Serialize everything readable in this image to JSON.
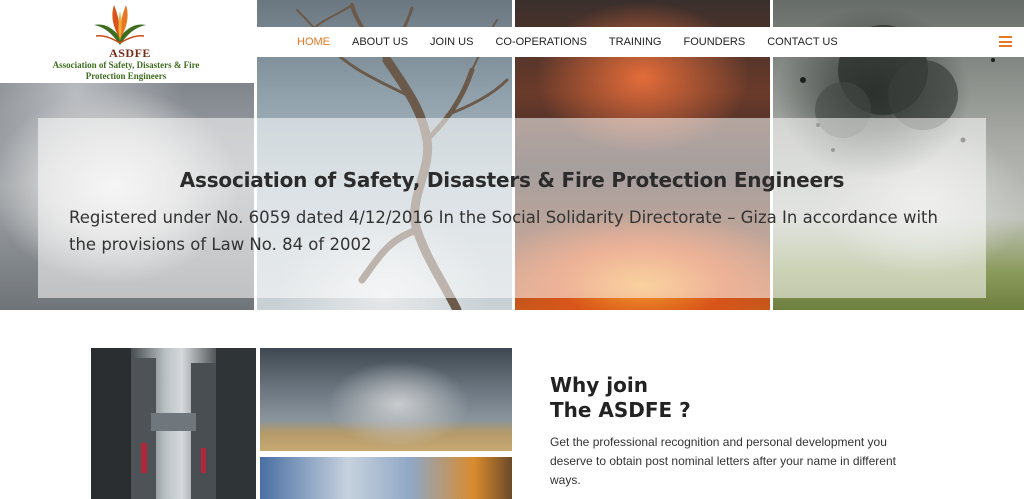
{
  "logo": {
    "title": "ASDFE",
    "subtitle": "Association of Safety, Disasters & Fire Protection Engineers",
    "icon": "flame-leaf-logo"
  },
  "nav": {
    "items": [
      {
        "label": "HOME",
        "active": true
      },
      {
        "label": "ABOUT US",
        "active": false
      },
      {
        "label": "JOIN US",
        "active": false
      },
      {
        "label": "CO-OPERATIONS",
        "active": false
      },
      {
        "label": "TRAINING",
        "active": false
      },
      {
        "label": "FOUNDERS",
        "active": false
      },
      {
        "label": "CONTACT US",
        "active": false
      }
    ],
    "menu_icon": "hamburger-icon"
  },
  "hero": {
    "title": "Association of Safety, Disasters & Fire Protection Engineers",
    "text": "Registered under No. 6059 dated 4/12/2016 In the Social Solidarity Directorate – Giza In accordance with the provisions of Law No. 84 of 2002"
  },
  "why": {
    "title_line1": "Why join",
    "title_line2": "The ASDFE ?",
    "text": "Get the professional recognition and personal development you deserve to obtain post nominal letters after your name in different ways."
  },
  "colors": {
    "accent": "#e87722",
    "logo_red": "#7a2b16",
    "logo_green": "#3e6d1f"
  }
}
